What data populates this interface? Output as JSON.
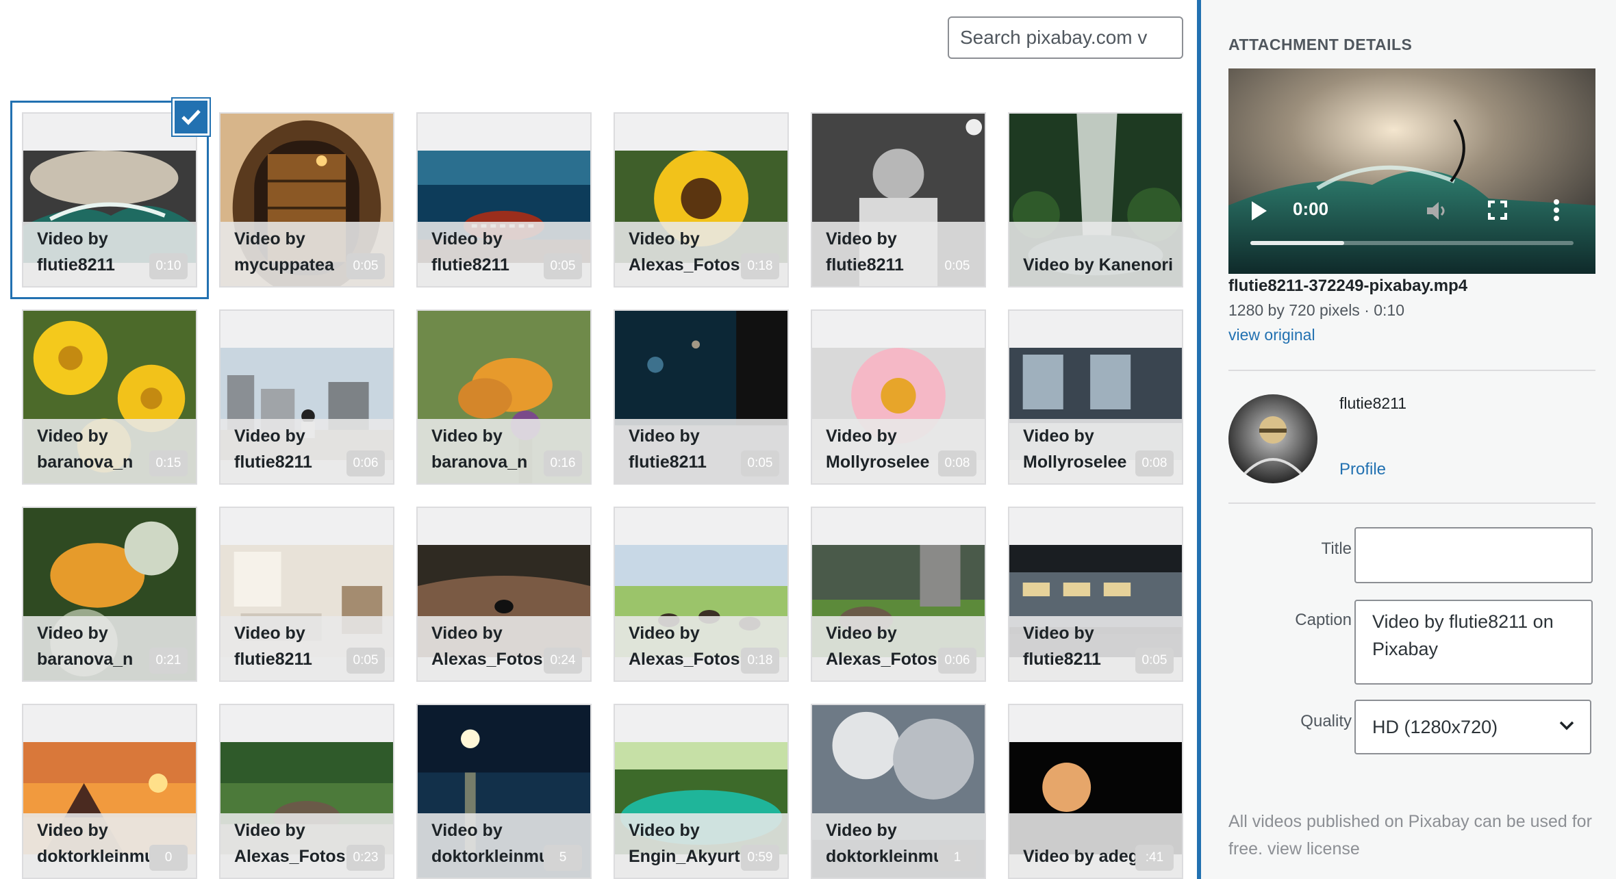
{
  "search": {
    "placeholder": "Search pixabay.com v"
  },
  "grid": {
    "items": [
      {
        "line1": "Video by",
        "line2": "flutie8211",
        "duration": "0:10",
        "selected": true,
        "scene": "wave"
      },
      {
        "line1": "Video by",
        "line2": "mycuppatea",
        "duration": "0:05",
        "scene": "books"
      },
      {
        "line1": "Video by",
        "line2": "flutie8211",
        "duration": "0:05",
        "scene": "reef"
      },
      {
        "line1": "Video by",
        "line2": "Alexas_Fotos",
        "duration": "0:18",
        "scene": "sunflower"
      },
      {
        "line1": "Video by",
        "line2": "flutie8211",
        "duration": "0:05",
        "scene": "scientist"
      },
      {
        "line1": "Video by Kanenori",
        "line2": "",
        "duration": "",
        "scene": "waterfall"
      },
      {
        "line1": "Video by",
        "line2": "baranova_n",
        "duration": "0:15",
        "scene": "yellowflowers"
      },
      {
        "line1": "Video by",
        "line2": "flutie8211",
        "duration": "0:06",
        "scene": "city"
      },
      {
        "line1": "Video by",
        "line2": "baranova_n",
        "duration": "0:16",
        "scene": "butterfly"
      },
      {
        "line1": "Video by",
        "line2": "flutie8211",
        "duration": "0:05",
        "scene": "window"
      },
      {
        "line1": "Video by",
        "line2": "Mollyroselee",
        "duration": "0:08",
        "scene": "daisy"
      },
      {
        "line1": "Video by",
        "line2": "Mollyroselee",
        "duration": "0:08",
        "scene": "interior"
      },
      {
        "line1": "Video by",
        "line2": "baranova_n",
        "duration": "0:21",
        "scene": "butterfly2"
      },
      {
        "line1": "Video by",
        "line2": "flutie8211",
        "duration": "0:05",
        "scene": "livingroom"
      },
      {
        "line1": "Video by",
        "line2": "Alexas_Fotos",
        "duration": "0:24",
        "scene": "duck"
      },
      {
        "line1": "Video by",
        "line2": "Alexas_Fotos",
        "duration": "0:18",
        "scene": "geese"
      },
      {
        "line1": "Video by",
        "line2": "Alexas_Fotos",
        "duration": "0:06",
        "scene": "goose"
      },
      {
        "line1": "Video by",
        "line2": "flutie8211",
        "duration": "0:05",
        "scene": "train"
      },
      {
        "line1": "Video by",
        "line2": "doktorkleinmusic",
        "duration": "0",
        "scene": "mountain"
      },
      {
        "line1": "Video by",
        "line2": "Alexas_Fotos",
        "duration": "0:23",
        "scene": "goose2"
      },
      {
        "line1": "Video by",
        "line2": "doktorkleinmusic",
        "duration": "5",
        "scene": "moonsea"
      },
      {
        "line1": "Video by",
        "line2": "Engin_Akyurt",
        "duration": "0:59",
        "scene": "lake"
      },
      {
        "line1": "Video by",
        "line2": "doktorkleinmusic",
        "duration": "1",
        "scene": "clouds"
      },
      {
        "line1": "Video by adege",
        "line2": "",
        "duration": ":41",
        "scene": "eclipse"
      }
    ]
  },
  "sidebar": {
    "heading": "ATTACHMENT DETAILS",
    "player": {
      "time": "0:00",
      "progress": 0.29
    },
    "filename": "flutie8211-372249-pixabay.mp4",
    "meta": "1280 by 720 pixels · 0:10",
    "view_original": "view original",
    "username": "flutie8211",
    "profile_link": "Profile",
    "title_label": "Title",
    "title_value": "",
    "caption_label": "Caption",
    "caption_value": "Video by flutie8211 on Pixabay",
    "quality_label": "Quality",
    "quality_value": "HD (1280x720)",
    "note_text": "All videos published on Pixabay can be used for free.",
    "note_link": "view license"
  }
}
